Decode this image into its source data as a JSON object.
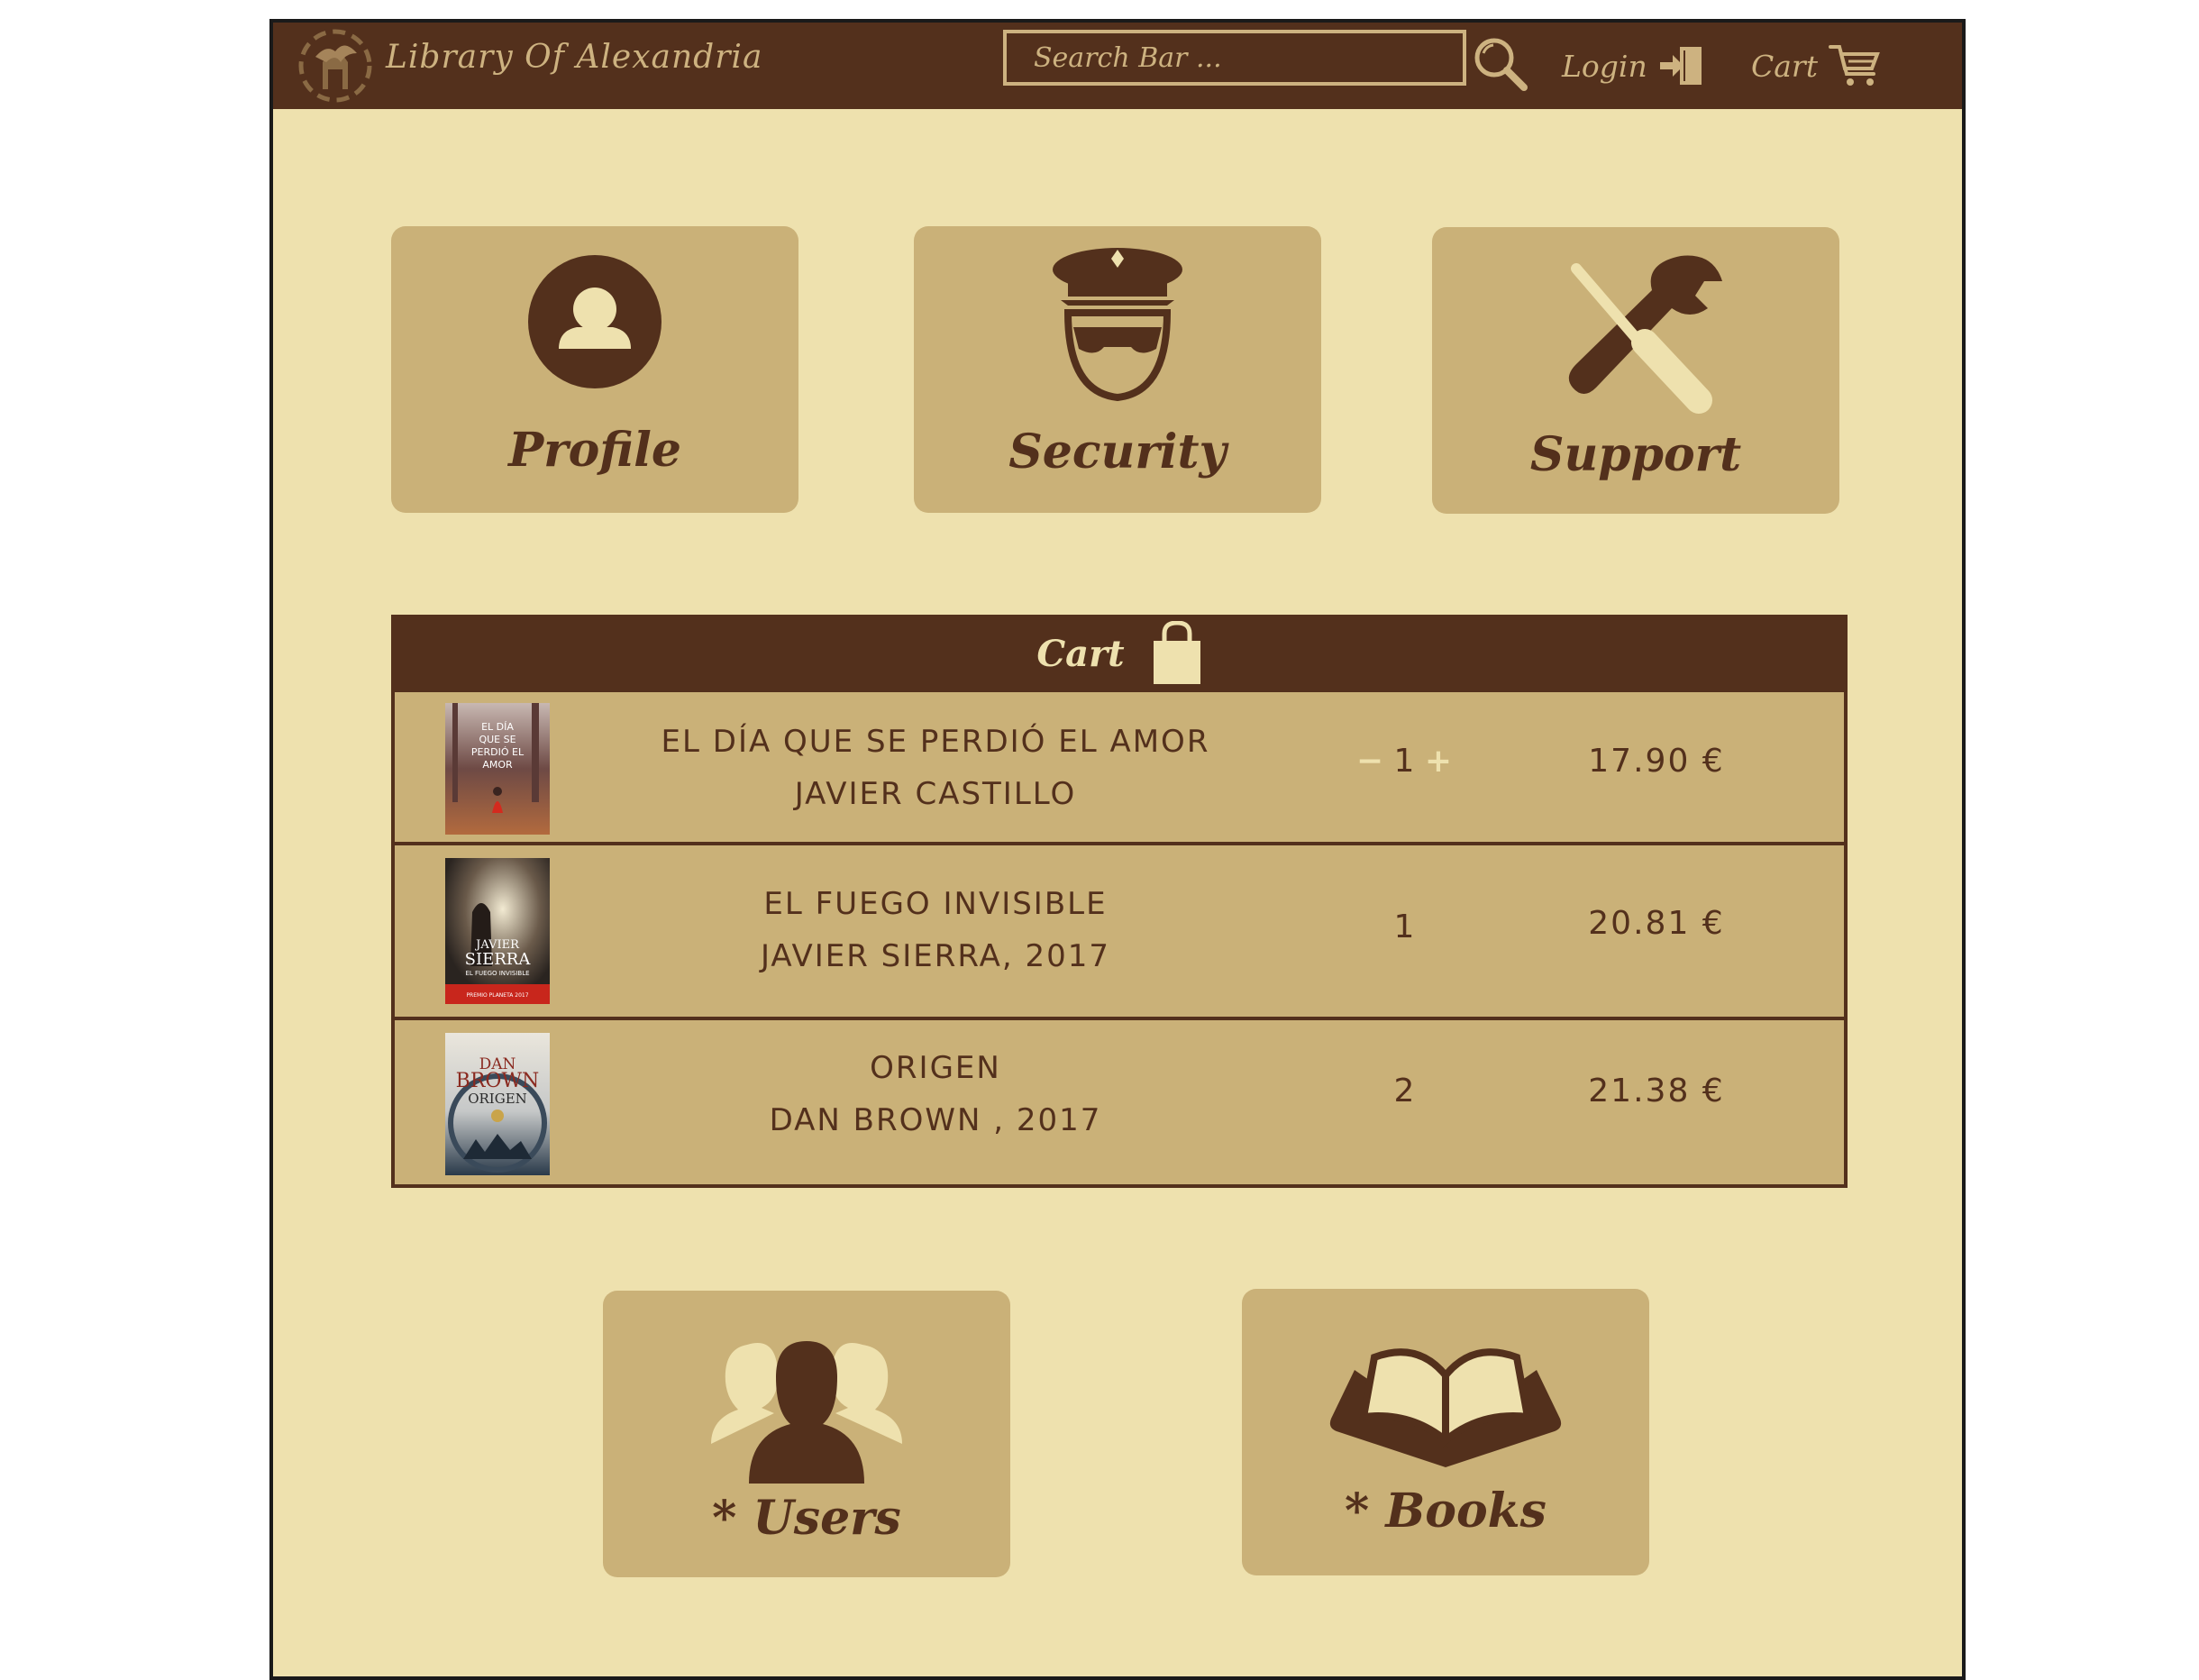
{
  "header": {
    "brand": "Library Of Alexandria",
    "search_placeholder": "Search Bar ...",
    "login_label": "Login",
    "cart_label": "Cart"
  },
  "tiles": {
    "profile": "Profile",
    "security": "Security",
    "support": "Support",
    "users": "* Users",
    "books": "* Books"
  },
  "cart": {
    "title": "Cart",
    "items": [
      {
        "title": "EL DÍA QUE SE PERDIÓ EL AMOR",
        "author": "JAVIER CASTILLO",
        "qty_minus": "−",
        "qty": "1",
        "qty_plus": "+",
        "price": "17.90 €",
        "cover_text": [
          "EL DÍA",
          "QUE SE",
          "PERDIÓ EL",
          "AMOR"
        ]
      },
      {
        "title": "EL FUEGO INVISIBLE",
        "author": "JAVIER SIERRA, 2017",
        "qty": "1",
        "price": "20.81 €",
        "cover_text": [
          "JAVIER",
          "SIERRA",
          "EL FUEGO INVISIBLE",
          "PREMIO PLANETA 2017"
        ]
      },
      {
        "title": "ORIGEN",
        "author": "DAN BROWN , 2017",
        "qty": "2",
        "price": "21.38 €",
        "cover_text": [
          "DAN",
          "BROWN",
          "ORIGEN"
        ]
      }
    ]
  },
  "colors": {
    "dark_brown": "#53301c",
    "tan": "#cab178",
    "cream": "#eee1ae",
    "gold": "#cdb280"
  }
}
